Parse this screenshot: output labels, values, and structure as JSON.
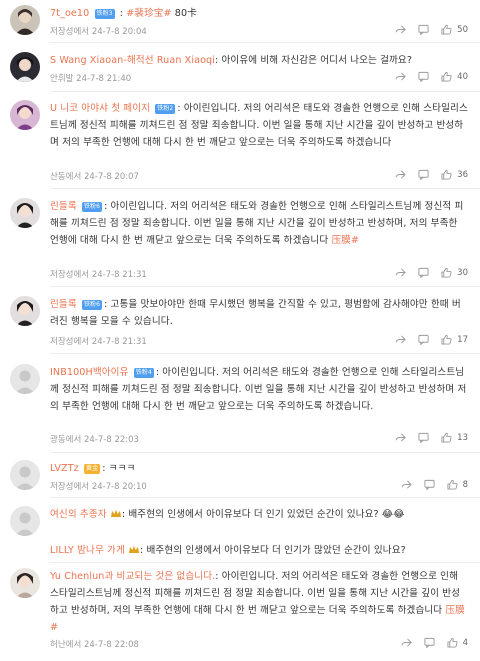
{
  "comments": [
    {
      "user": "7t_oe10",
      "badge": "铁粉3",
      "tag": "#裴珍宝#",
      "extra": "80卡",
      "location": "저장성에서",
      "time": "24-7-8 20:04",
      "likes": "50"
    },
    {
      "user": "S Wang Xiaoan-해적선 Ruan Xiaoqi",
      "text": "아이유에 비해 자신감은 어디서 나오는 걸까요?",
      "location": "안휘발",
      "time": "24-7-8 21:40",
      "likes": "40"
    },
    {
      "user": "U 니코 아야샤 첫 페이지",
      "badge": "铁粉2",
      "text": "아이린입니다. 저의 어리석은 태도와 경솔한 언행으로 인해 스타일리스트님께 정신적 피해를 끼쳐드린 점 정말 죄송합니다. 이번 일을 통해 지난 시간을 깊이 반성하고 반성하며 저의 부족한 언행에 대해 다시 한 번 깨닫고 앞으로는 더욱 주의하도록 하겠습니다",
      "location": "산동에서",
      "time": "24-7-8 20:07",
      "likes": "36"
    },
    {
      "user": "린들록",
      "badge": "铁粉6",
      "text": "아이린입니다. 저의 어리석은 태도와 경솔한 언행으로 인해 스타일리스트님께 정신적 피해를 끼쳐드린 점 정말 죄송합니다. 이번 일을 통해 지난 시간을 깊이 반성하고 반성하며, 저의 부족한 언행에 대해 다시 한 번 깨닫고 앞으로는 더욱 주의하도록 하겠습니다",
      "tag": "压膜#",
      "location": "저장성에서",
      "time": "24-7-8 21:31",
      "likes": "30"
    },
    {
      "user": "린들록",
      "badge": "铁粉6",
      "text": "고통을 맛보아야만 한때 무시했던 행복을 간직할 수 있고, 평범함에 감사해야만 한때 버려진 행복을 모을 수 있습니다.",
      "location": "저장성에서",
      "time": "24-7-8 21:31",
      "likes": "17"
    },
    {
      "user": "INB100H백아이유",
      "badge": "铁粉4",
      "text": "아이린입니다. 저의 어리석은 태도와 경솔한 언행으로 인해 스타일리스트님께 정신적 피해를 끼쳐드린 점 정말 죄송합니다. 이번 일을 통해 지난 시간을 깊이 반성하고 반성하며 저의 부족한 언행에 대해 다시 한 번 깨닫고 앞으로는 더욱 주의하도록 하겠습니다.",
      "location": "광동에서",
      "time": "24-7-8 22:03",
      "likes": "13"
    },
    {
      "user": "LVZTz",
      "badge": "黄金",
      "text": "ㅋㅋㅋ",
      "location": "저장성에서",
      "time": "24-7-8 20:10",
      "likes": "8"
    },
    {
      "user": "여신의 추종자",
      "text": "배주현의 인생에서 아이유보다 더 인기 있었던 순간이 있나요?",
      "emoji": "😂😂",
      "reply_user": "LILLY 밤나무 가게",
      "reply_text": "배주현의 인생에서 아이유보다 더 인기가 많았던 순간이 있나요?"
    },
    {
      "user": "Yu Chenlun과 비교되는 것은 없습니다.",
      "text": "아이린입니다. 저의 어리석은 태도와 경솔한 언행으로 인해 스타일리스트님께 정신적 피해를 끼쳐드린 점 정말 죄송합니다. 이번 일을 통해 지난 시간을 깊이 반성하고 반성하며, 저의 부족한 언행에 대해 다시 한 번 깨닫고 앞으로는 더욱 주의하도록 하겠습니다",
      "tag": "压膜#",
      "location": "허난에서",
      "time": "24-7-8 22:08",
      "likes": "4"
    }
  ],
  "colors": {
    "username": "#eb7350",
    "meta": "#999999",
    "badge": "#4f9ef0",
    "gold": "#f5b230"
  },
  "icons": [
    "share-icon",
    "comment-icon",
    "like-icon"
  ]
}
